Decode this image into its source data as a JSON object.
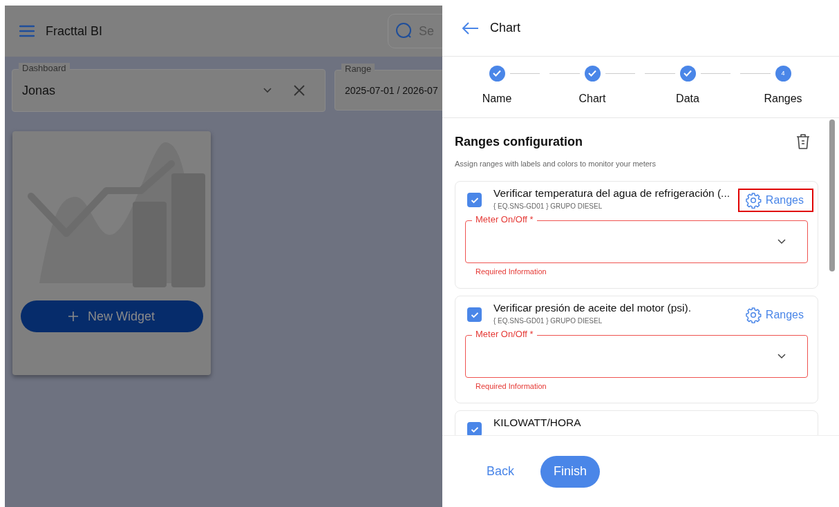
{
  "app": {
    "title": "Fracttal BI",
    "search": {
      "placeholder": "Se"
    }
  },
  "filters": [
    {
      "label": "Dashboard",
      "value": "Jonas",
      "clearable": true
    },
    {
      "label": "Range",
      "value": "2025-07-01 / 2026-07",
      "clearable": false
    }
  ],
  "widget_card": {
    "button": "New Widget"
  },
  "panel": {
    "title": "Chart",
    "steps": [
      {
        "label": "Name",
        "completed": true
      },
      {
        "label": "Chart",
        "completed": true
      },
      {
        "label": "Data",
        "completed": true
      },
      {
        "label": "Ranges",
        "completed": false,
        "number": "4"
      }
    ],
    "section": {
      "title": "Ranges configuration",
      "description": "Assign ranges with labels and colors to monitor your meters"
    },
    "items": [
      {
        "title": "Verificar temperatura del agua de refrigeración (...",
        "subtitle": "{ EQ.SNS-GD01 } GRUPO DIESEL",
        "checked": true,
        "action": "Ranges",
        "highlighted": true,
        "field": {
          "label": "Meter On/Off *",
          "error": true,
          "helper": "Required Information"
        }
      },
      {
        "title": "Verificar presión de aceite del motor (psi).",
        "subtitle": "{ EQ.SNS-GD01 } GRUPO DIESEL",
        "checked": true,
        "action": "Ranges",
        "highlighted": false,
        "field": {
          "label": "Meter On/Off *",
          "error": true,
          "helper": "Required Information"
        }
      },
      {
        "title": "KILOWATT/HORA",
        "checked": true
      }
    ],
    "footer": {
      "back": "Back",
      "finish": "Finish"
    }
  }
}
